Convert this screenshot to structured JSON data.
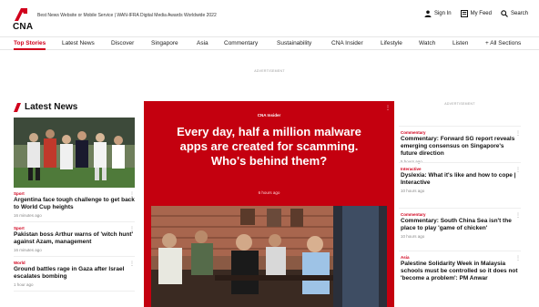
{
  "brand": {
    "logo_text": "CNA",
    "tagline": "Best News Website or Mobile Service | WAN-IFRA Digital Media Awards Worldwide 2022",
    "accent": "#d1001c",
    "hero_bg": "#c4000f"
  },
  "top_actions": [
    {
      "label": "Sign In",
      "icon": "user-icon"
    },
    {
      "label": "My Feed",
      "icon": "feed-icon"
    },
    {
      "label": "Search",
      "icon": "search-icon"
    }
  ],
  "nav": [
    "Top Stories",
    "Latest News",
    "Discover",
    "Singapore",
    "Asia",
    "Commentary",
    "Sustainability",
    "CNA Insider",
    "Lifestyle",
    "Watch",
    "Listen",
    "+ All Sections"
  ],
  "ad_label": "ADVERTISEMENT",
  "latest": {
    "title": "Latest News",
    "stories": [
      {
        "category": "Sport",
        "title": "Argentina face tough challenge to get back to World Cup heights",
        "time": "16 minutes ago"
      },
      {
        "category": "Sport",
        "title": "Pakistan boss Arthur warns of 'witch hunt' against Azam, management",
        "time": "16 minutes ago"
      },
      {
        "category": "World",
        "title": "Ground battles rage in Gaza after Israel escalates bombing",
        "time": "1 hour ago"
      }
    ]
  },
  "hero": {
    "tag": "CNA Insider",
    "title": "Every day, half a million malware apps are created for scamming. Who's behind them?",
    "time": "6 hours ago"
  },
  "right": {
    "ad_label": "ADVERTISEMENT",
    "stories": [
      {
        "category": "Commentary",
        "title": "Commentary: Forward SG report reveals emerging consensus on Singapore's future direction",
        "time": "5 hours ago"
      },
      {
        "category": "Interactive",
        "title": "Dyslexia: What it's like and how to cope | Interactive",
        "time": "10 hours ago"
      },
      {
        "category": "Commentary",
        "title": "Commentary: South China Sea isn't the place to play 'game of chicken'",
        "time": "10 hours ago"
      },
      {
        "category": "Asia",
        "title": "Palestine Solidarity Week in Malaysia schools must be controlled so it does not 'become a problem': PM Anwar",
        "time": ""
      }
    ]
  }
}
